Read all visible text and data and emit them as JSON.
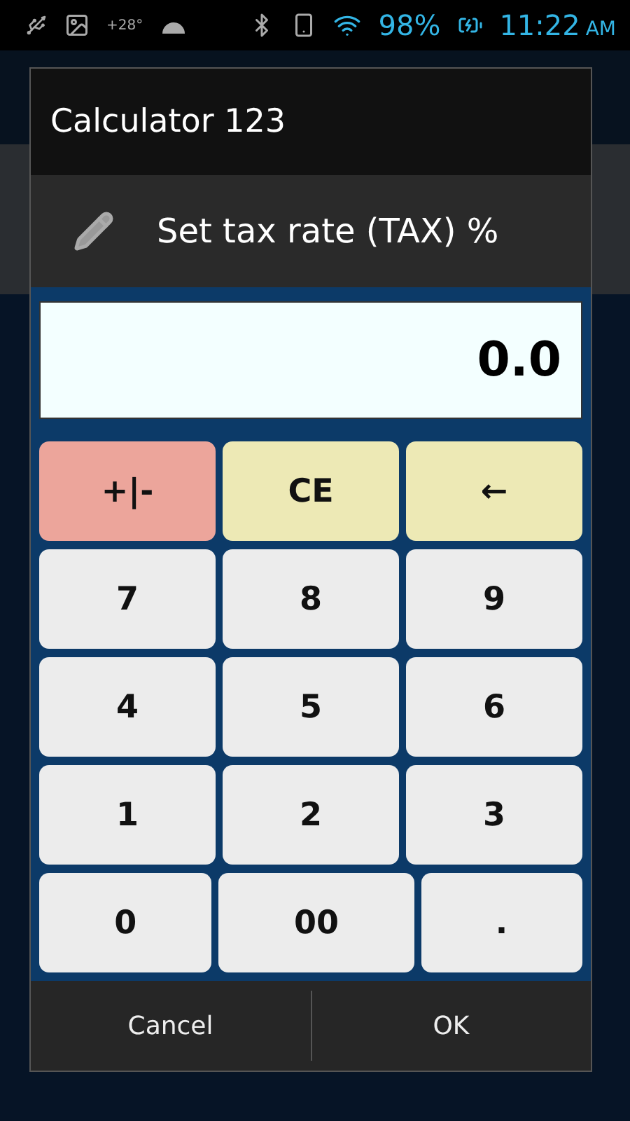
{
  "status_bar": {
    "temperature": "+28°",
    "battery": "98%",
    "time": "11:22",
    "meridiem": "AM"
  },
  "dialog": {
    "title": "Calculator 123",
    "prompt": "Set tax rate (TAX) %",
    "display": "0.0",
    "keys": [
      [
        {
          "label": "+|-",
          "kind": "sign"
        },
        {
          "label": "CE",
          "kind": "edit"
        },
        {
          "label": "←",
          "kind": "edit"
        }
      ],
      [
        {
          "label": "7",
          "kind": "digit"
        },
        {
          "label": "8",
          "kind": "digit"
        },
        {
          "label": "9",
          "kind": "digit"
        }
      ],
      [
        {
          "label": "4",
          "kind": "digit"
        },
        {
          "label": "5",
          "kind": "digit"
        },
        {
          "label": "6",
          "kind": "digit"
        }
      ],
      [
        {
          "label": "1",
          "kind": "digit"
        },
        {
          "label": "2",
          "kind": "digit"
        },
        {
          "label": "3",
          "kind": "digit"
        }
      ],
      [
        {
          "label": "0",
          "kind": "digit"
        },
        {
          "label": "00",
          "kind": "digit"
        },
        {
          "label": ".",
          "kind": "digit"
        }
      ]
    ],
    "buttons": [
      "Cancel",
      "OK"
    ]
  }
}
